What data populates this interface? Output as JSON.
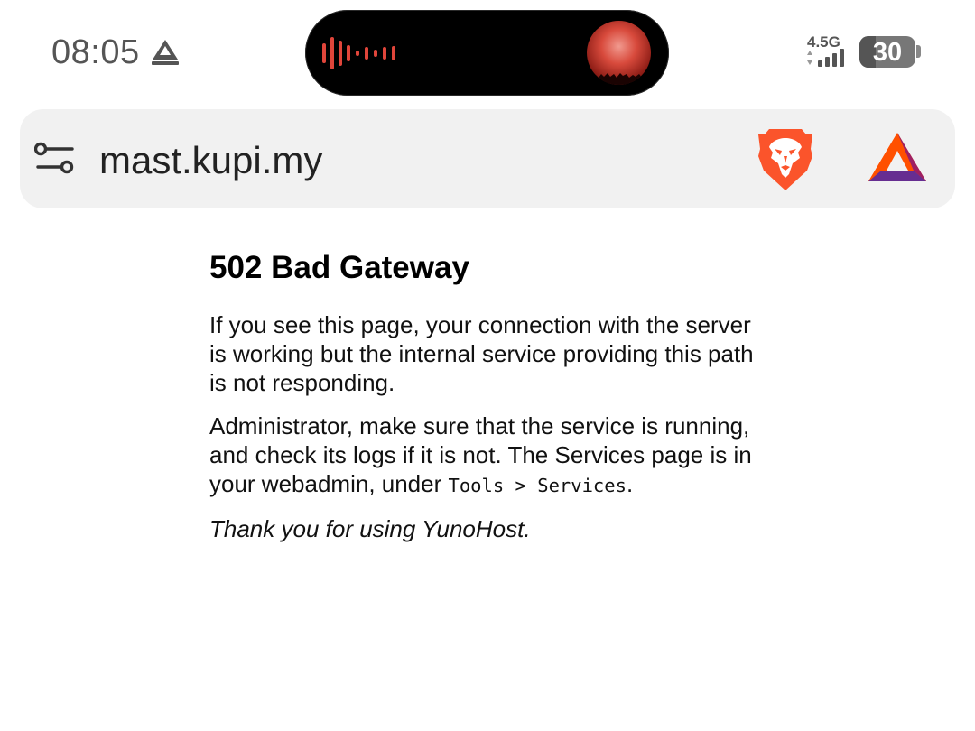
{
  "status_bar": {
    "time": "08:05",
    "network_type": "4.5G",
    "battery_level": "30",
    "icons": {
      "left": "google-drive-upload-icon",
      "island_waveform": "audio-waveform-icon",
      "island_art": "album-art",
      "signal": "signal-strength-icon",
      "battery": "battery-icon"
    }
  },
  "address_bar": {
    "url": "mast.kupi.my",
    "icons": [
      "site-settings-icon",
      "brave-shields-icon",
      "brave-rewards-icon"
    ]
  },
  "page": {
    "title": "502 Bad Gateway",
    "paragraph1": "If you see this page, your connection with the server is working but the internal service providing this path is not responding.",
    "paragraph2_text": "Administrator, make sure that the service is running, and check its logs if it is not. The Services page is in your webadmin, under ",
    "paragraph2_code": "Tools > Services",
    "paragraph2_end": ".",
    "thanks": "Thank you for using YunoHost."
  },
  "colors": {
    "waveform": "#e0453a",
    "brave_orange": "#fb542b",
    "bat_orange": "#ff5000",
    "bat_purple": "#662d91",
    "bat_red": "#9e1f63"
  }
}
